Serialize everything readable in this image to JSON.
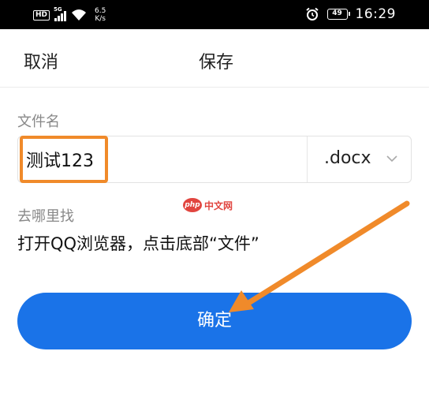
{
  "status_bar": {
    "hd": "HD",
    "network_gen": "5G",
    "speed_value": "6.5",
    "speed_unit": "K/s",
    "battery": "49",
    "time": "16:29"
  },
  "header": {
    "cancel_label": "取消",
    "title": "保存"
  },
  "filename": {
    "label": "文件名",
    "value": "测试123",
    "extension": ".docx"
  },
  "where": {
    "label": "去哪里找",
    "value": "打开QQ浏览器，点击底部“文件”"
  },
  "watermark": {
    "logo": "php",
    "text": "中文网"
  },
  "confirm_label": "确定",
  "colors": {
    "accent": "#1a73e8",
    "highlight": "#f08a2a"
  }
}
